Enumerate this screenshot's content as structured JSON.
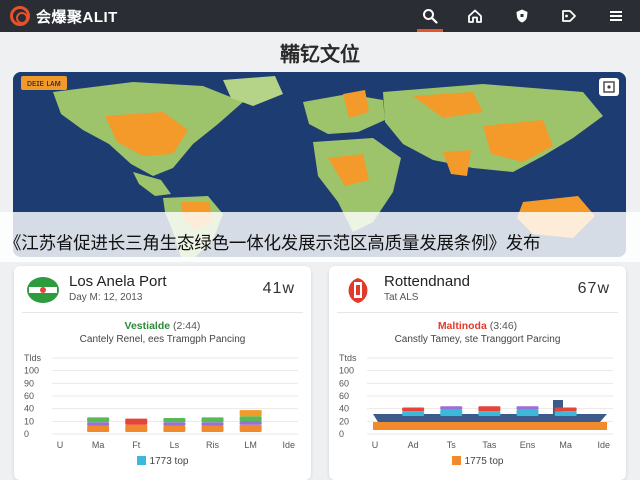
{
  "app": {
    "brand": "会爆聚ALIT",
    "nav": [
      {
        "name": "search",
        "icon": "search-icon",
        "active": true
      },
      {
        "name": "home",
        "icon": "home-icon",
        "active": false
      },
      {
        "name": "shield",
        "icon": "shield-icon",
        "active": false
      },
      {
        "name": "tag",
        "icon": "tag-icon",
        "active": false
      },
      {
        "name": "menu",
        "icon": "menu-icon",
        "active": false
      }
    ]
  },
  "page": {
    "title": "鞴钇文位"
  },
  "hero": {
    "tag": "ᴅᴇɪᴇ ʟᴀᴍ",
    "headline": "《江苏省促进长三角生态绿色一体化发展示范区高质量发展条例》发布"
  },
  "colors": {
    "accent": "#e4532c",
    "highlight_land": "#f39a2b",
    "land": "#9dc46b",
    "ocean": "#1d3c72",
    "topbar": "#2a2d33"
  },
  "cards": [
    {
      "name": "Los Anela Port",
      "date": "Day M: 12, 2013",
      "wind": "41w",
      "status": "Vestialde",
      "status_num": "(2:44)",
      "status_color": "#2e8b3a",
      "desc": "Cantely Renel, ees Tramgph Pancing",
      "badge": "green-flag-icon",
      "y_ticks": [
        "Tlds",
        "100",
        "90",
        "60",
        "40",
        "10",
        "0"
      ],
      "x_ticks": [
        "U",
        "Ma",
        "Ft",
        "Ls",
        "Ris",
        "LM",
        "Ide"
      ],
      "legend_swatch": "#3cb8d8",
      "legend": "1773 top",
      "chart_data": {
        "type": "bar",
        "categories": [
          "U",
          "Ma",
          "Ft",
          "Ls",
          "Ris",
          "LM",
          "Ide"
        ],
        "series": [
          {
            "color": "#f08a2c",
            "values": [
              0,
              10,
              12,
              10,
              10,
              12,
              0
            ]
          },
          {
            "color": "#9b6fd8",
            "values": [
              0,
              6,
              0,
              6,
              6,
              6,
              0
            ]
          },
          {
            "color": "#58b957",
            "values": [
              0,
              8,
              0,
              7,
              8,
              8,
              0
            ]
          },
          {
            "color": "#e4443a",
            "values": [
              0,
              0,
              10,
              0,
              0,
              0,
              0
            ]
          },
          {
            "color": "#f39a2b",
            "values": [
              0,
              0,
              0,
              0,
              0,
              10,
              0
            ]
          }
        ],
        "ylim": [
          0,
          100
        ]
      }
    },
    {
      "name": "Rottendnand",
      "date": "Tat ALS",
      "wind": "67w",
      "status": "Maltinoda",
      "status_num": "(3:46)",
      "status_color": "#e23a2a",
      "desc": "Canstly Tamey, ste Tranggort Parcing",
      "badge": "red-flag-icon",
      "y_ticks": [
        "Ttds",
        "100",
        "60",
        "60",
        "40",
        "20",
        "0"
      ],
      "x_ticks": [
        "U",
        "Ad",
        "Ts",
        "Tas",
        "Ens",
        "Ma",
        "Ide"
      ],
      "legend_swatch": "#f08a2c",
      "legend": "1775 top",
      "chart_data": {
        "type": "bar",
        "categories": [
          "U",
          "Ad",
          "Ts",
          "Tas",
          "Ens",
          "Ma",
          "Ide"
        ],
        "series": [
          {
            "color": "#3cb8d8",
            "values": [
              0,
              8,
              10,
              8,
              10,
              8,
              0
            ]
          },
          {
            "color": "#9b6fd8",
            "values": [
              0,
              0,
              6,
              0,
              6,
              0,
              0
            ]
          },
          {
            "color": "#e4443a",
            "values": [
              0,
              6,
              0,
              8,
              0,
              6,
              0
            ]
          }
        ],
        "ylim": [
          0,
          100
        ]
      }
    }
  ]
}
